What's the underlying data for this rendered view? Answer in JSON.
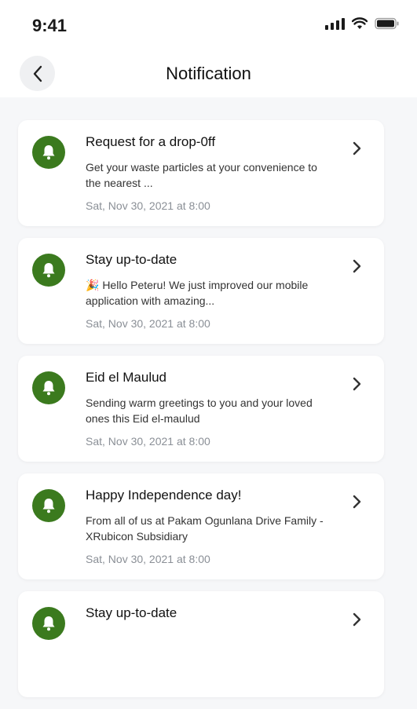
{
  "status": {
    "time": "9:41"
  },
  "header": {
    "title": "Notification"
  },
  "notifications": [
    {
      "title": "Request for a drop-0ff",
      "body": "Get your waste particles at your convenience to the nearest ...",
      "date": "Sat, Nov 30, 2021 at 8:00"
    },
    {
      "title": "Stay up-to-date",
      "body": "🎉 Hello Peteru! We just improved our mobile application with amazing...",
      "date": "Sat, Nov 30, 2021 at 8:00"
    },
    {
      "title": "Eid el Maulud",
      "body": "Sending warm greetings to you and your loved ones this Eid el-maulud",
      "date": "Sat, Nov 30, 2021 at 8:00"
    },
    {
      "title": "Happy Independence day!",
      "body": "From all of us at Pakam Ogunlana Drive Family - XRubicon Subsidiary",
      "date": "Sat, Nov 30, 2021 at 8:00"
    },
    {
      "title": "Stay up-to-date",
      "body": "",
      "date": ""
    }
  ],
  "colors": {
    "accent": "#3b7a1e",
    "background": "#f6f7f9"
  }
}
